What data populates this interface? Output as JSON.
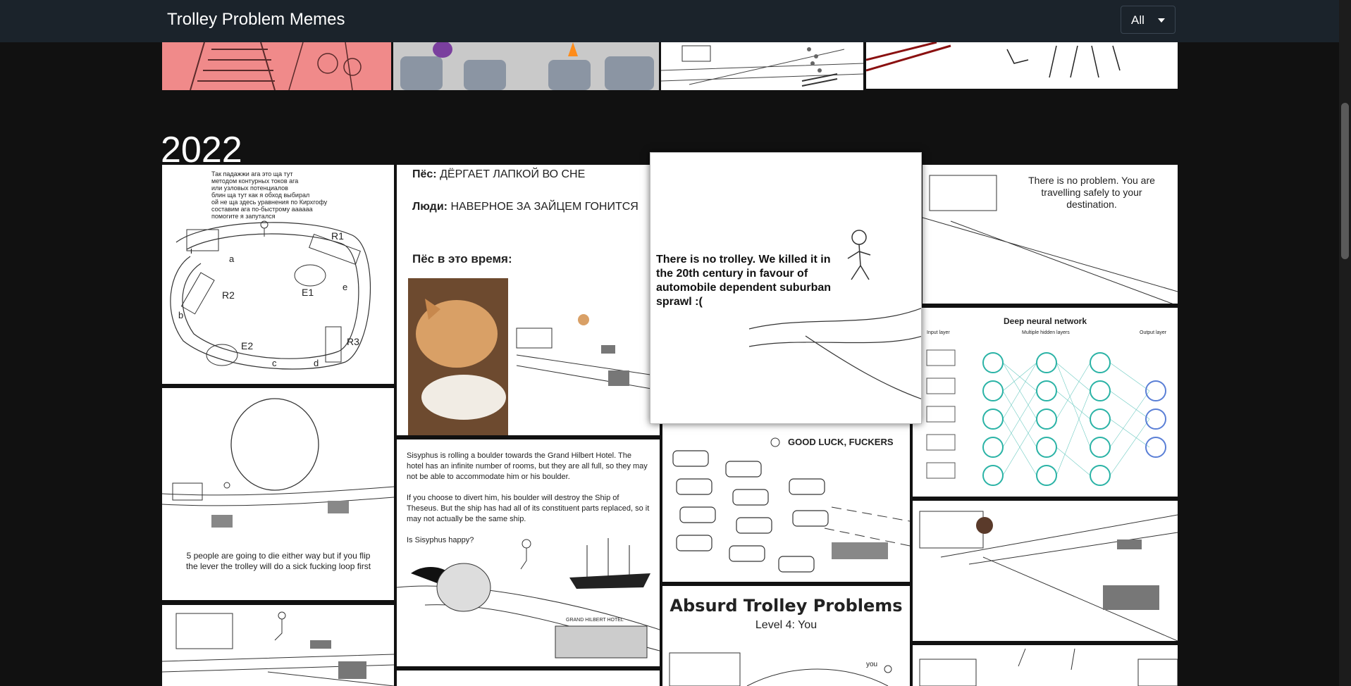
{
  "app": {
    "title": "Trolley Problem Memes"
  },
  "filter": {
    "selected": "All"
  },
  "section": {
    "year": "2022"
  },
  "memes": {
    "circuit": {
      "text": "Так падажжи ага это ща тут\nметодом контурных токов ага\nили узловых потенциалов\nблин ща тут как я обход выбирал\nой не ща здесь уравнения по Кирхгофу\nсоставим ага по-быстрому аааааа\nпомогите я запутался",
      "r1": "R1",
      "r2": "R2",
      "r3": "R3",
      "e1": "E1",
      "e2": "E2",
      "a": "a",
      "b": "b",
      "c": "c",
      "d": "d",
      "e": "e",
      "i": "i"
    },
    "dog": {
      "line1_label": "Пёс:",
      "line1_text": "ДЁРГАЕТ ЛАПКОЙ ВО СНЕ",
      "line2_label": "Люди:",
      "line2_text": "НАВЕРНОЕ ЗА ЗАЙЦЕМ ГОНИТСЯ",
      "line3_label": "Пёс в это время:"
    },
    "no_trolley": {
      "text": "There is no trolley. We killed it in the 20th century in favour of automobile dependent suburban sprawl :("
    },
    "no_problem": {
      "text": "There is no problem. You are travelling safely to your destination."
    },
    "neural": {
      "title": "Deep neural network",
      "input": "Input layer",
      "hidden": "Multiple hidden layers",
      "output": "Output layer"
    },
    "loop": {
      "caption": "5 people are going to die either way but if you flip the lever the trolley will do a sick fucking loop first"
    },
    "sisyphus": {
      "p1": "Sisyphus is rolling a boulder towards the Grand Hilbert Hotel. The hotel has an infinite number of rooms, but they are all full, so they may not be able to accommodate him or his boulder.",
      "p2": "If you choose to divert him, his boulder will destroy the Ship of Theseus. But the ship has had all of its constituent parts replaced, so it may not actually be the same ship.",
      "p3": "Is Sisyphus happy?",
      "hotel": "GRAND HILBERT HOTEL"
    },
    "cars": {
      "text": "GOOD LUCK, FUCKERS"
    },
    "absurd": {
      "title": "Absurd Trolley Problems",
      "subtitle": "Level 4: You",
      "you": "you"
    }
  }
}
